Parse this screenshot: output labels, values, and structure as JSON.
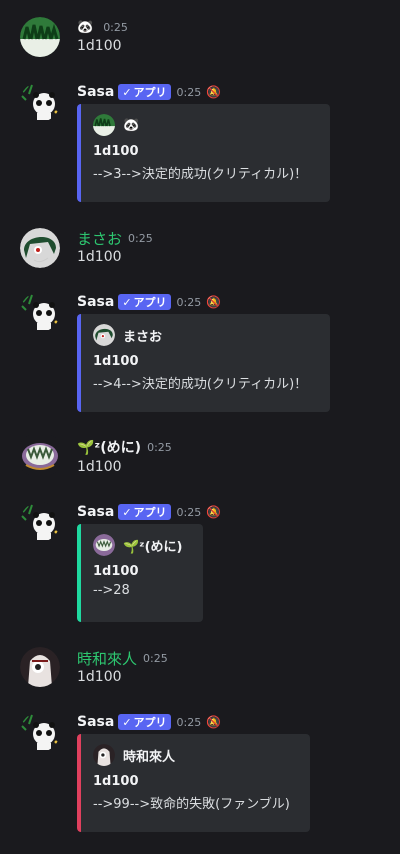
{
  "messages": [
    {
      "user": {
        "name": "🐼",
        "avatar": "crowd-avatar"
      },
      "time": "0:25",
      "text": "1d100"
    },
    {
      "user": {
        "name": "Sasa",
        "avatar": "panda-bot-avatar",
        "tag": "アプリ"
      },
      "time": "0:25",
      "embed": {
        "author": "🐼",
        "title": "1d100",
        "description": "-->3-->決定的成功(クリティカル)！",
        "color": "#5865f2"
      }
    },
    {
      "user": {
        "name": "まさお",
        "avatar": "green-hair-avatar"
      },
      "time": "0:25",
      "text": "1d100"
    },
    {
      "user": {
        "name": "Sasa",
        "avatar": "panda-bot-avatar",
        "tag": "アプリ"
      },
      "time": "0:25",
      "embed": {
        "author": "まさお",
        "title": "1d100",
        "description": "-->4-->決定的成功(クリティカル)！",
        "color": "#5865f2"
      }
    },
    {
      "user": {
        "name": "🌱ᶻ(めに)",
        "avatar": "monster-avatar"
      },
      "time": "0:25",
      "text": "1d100"
    },
    {
      "user": {
        "name": "Sasa",
        "avatar": "panda-bot-avatar",
        "tag": "アプリ"
      },
      "time": "0:25",
      "embed": {
        "author": "🌱ᶻ(めに)",
        "title": "1d100",
        "description": "-->28",
        "color": "#1fd9a0"
      }
    },
    {
      "user": {
        "name": "時和來人",
        "avatar": "white-hair-avatar"
      },
      "time": "0:25",
      "text": "1d100"
    },
    {
      "user": {
        "name": "Sasa",
        "avatar": "panda-bot-avatar",
        "tag": "アプリ"
      },
      "time": "0:25",
      "embed": {
        "author": "時和來人",
        "title": "1d100",
        "description": "-->99-->致命的失敗(ファンブル)",
        "color": "#e0405e"
      }
    }
  ],
  "icons": {
    "app_tag_check": "check-icon",
    "notify": "bell-slash-icon"
  }
}
